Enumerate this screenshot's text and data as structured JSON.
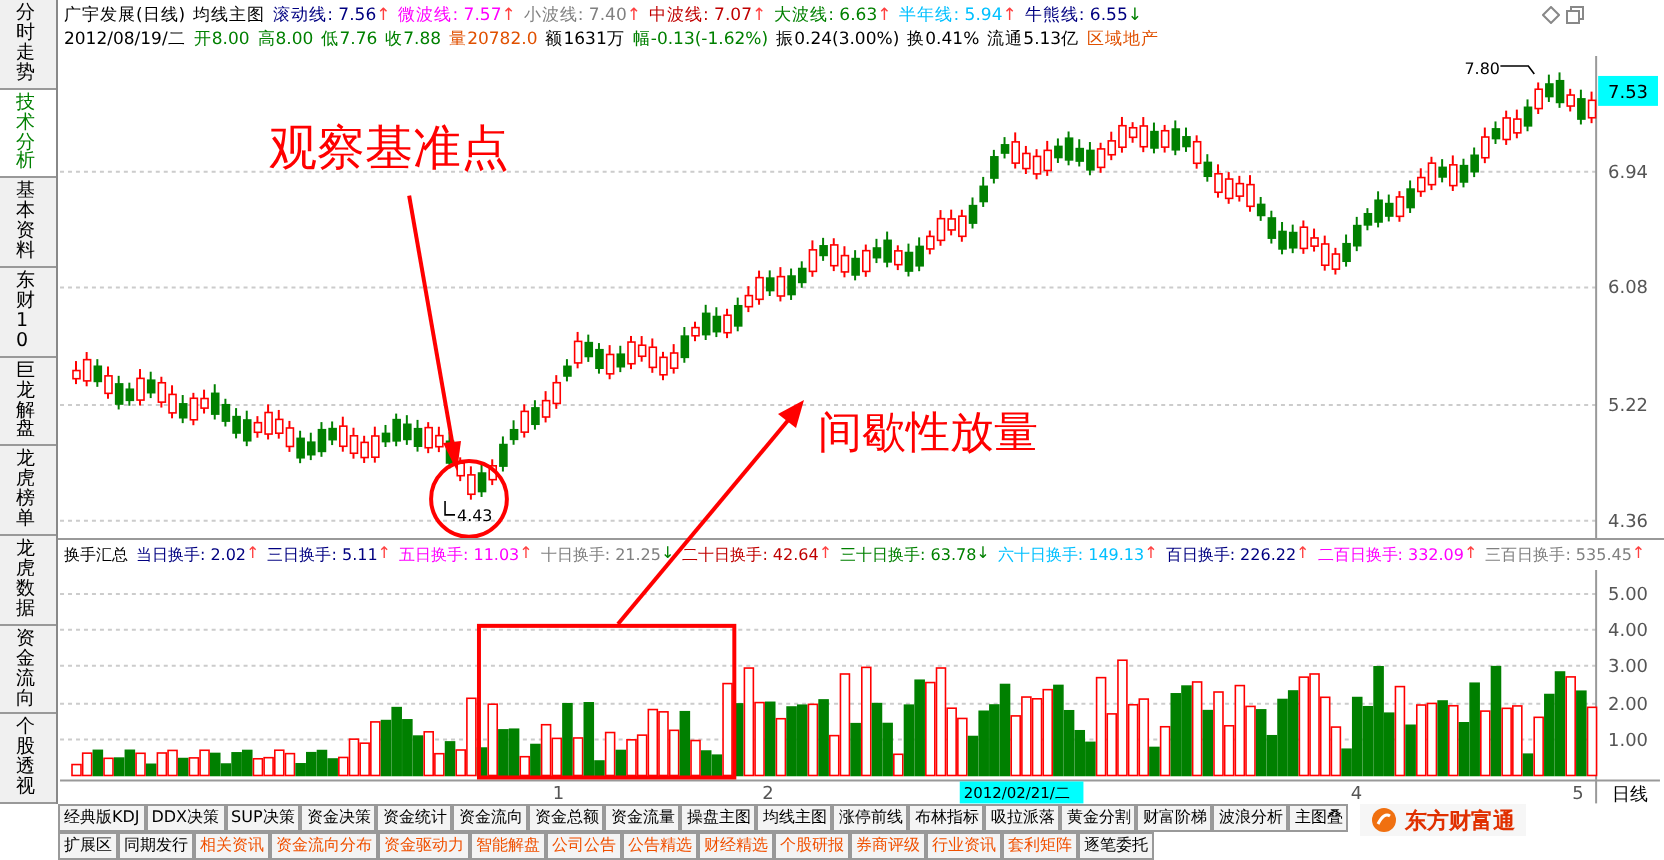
{
  "side_tabs": [
    {
      "label": "分时走势",
      "selected": false
    },
    {
      "label": "技术分析",
      "selected": true
    },
    {
      "label": "基本资料",
      "selected": false
    },
    {
      "label": "东财10",
      "selected": false
    },
    {
      "label": "巨龙解盘",
      "selected": false
    },
    {
      "label": "龙虎榜单",
      "selected": false
    },
    {
      "label": "龙虎数据",
      "selected": false
    },
    {
      "label": "资金流向",
      "selected": false
    },
    {
      "label": "个股透视",
      "selected": false
    }
  ],
  "header": {
    "title": "广宇发展(日线)",
    "indicator": "均线主图",
    "lines": [
      {
        "name": "滚动线:",
        "value": "7.56",
        "arrow": "↑",
        "up": true,
        "color": "#000080"
      },
      {
        "name": "微波线:",
        "value": "7.57",
        "arrow": "↑",
        "up": true,
        "color": "#ff00ff"
      },
      {
        "name": "小波线:",
        "value": "7.40",
        "arrow": "↑",
        "up": true,
        "color": "#808080"
      },
      {
        "name": "中波线:",
        "value": "7.07",
        "arrow": "↑",
        "up": true,
        "color": "#c00000"
      },
      {
        "name": "大波线:",
        "value": "6.63",
        "arrow": "↑",
        "up": true,
        "color": "#008000"
      },
      {
        "name": "半年线:",
        "value": "5.94",
        "arrow": "↑",
        "up": true,
        "color": "#00c0ff"
      },
      {
        "name": "牛熊线:",
        "value": "6.55",
        "arrow": "↓",
        "up": false,
        "color": "#000080"
      }
    ]
  },
  "quote": {
    "date": "2012/08/19/二",
    "items": [
      {
        "label": "开",
        "value": "8.00",
        "color": "#008000"
      },
      {
        "label": "高",
        "value": "8.00",
        "color": "#008000"
      },
      {
        "label": "低",
        "value": "7.76",
        "color": "#008000"
      },
      {
        "label": "收",
        "value": "7.88",
        "color": "#008000"
      },
      {
        "label": "量",
        "value": "20782.0",
        "color": "#e05000"
      },
      {
        "label": "额",
        "value": "1631万",
        "color": "#000000"
      },
      {
        "label": "幅",
        "value": "-0.13(-1.62%)",
        "color": "#008000"
      },
      {
        "label": "振",
        "value": "0.24(3.00%)",
        "color": "#000000"
      },
      {
        "label": "换",
        "value": "0.41%",
        "color": "#000000"
      },
      {
        "label": "流通",
        "value": "5.13亿",
        "color": "#000000"
      }
    ],
    "sector": "区域地产"
  },
  "price_axis": {
    "current": "7.53",
    "ticks": [
      "6.94",
      "6.08",
      "5.22",
      "4.36"
    ]
  },
  "annotations": {
    "base_point": "观察基准点",
    "low_label": "4.43",
    "high_label": "7.80",
    "volume_note": "间歇性放量"
  },
  "turnover": {
    "title": "换手汇总",
    "items": [
      {
        "name": "当日换手:",
        "value": "2.02",
        "arrow": "↑",
        "up": true,
        "color": "#000080"
      },
      {
        "name": "三日换手:",
        "value": "5.11",
        "arrow": "↑",
        "up": true,
        "color": "#000080"
      },
      {
        "name": "五日换手:",
        "value": "11.03",
        "arrow": "↑",
        "up": true,
        "color": "#ff00ff"
      },
      {
        "name": "十日换手:",
        "value": "21.25",
        "arrow": "↓",
        "up": false,
        "color": "#808080"
      },
      {
        "name": "二十日换手:",
        "value": "42.64",
        "arrow": "↑",
        "up": true,
        "color": "#c00000"
      },
      {
        "name": "三十日换手:",
        "value": "63.78",
        "arrow": "↓",
        "up": false,
        "color": "#008000"
      },
      {
        "name": "六十日换手:",
        "value": "149.13",
        "arrow": "↑",
        "up": true,
        "color": "#00c0ff"
      },
      {
        "name": "百日换手:",
        "value": "226.22",
        "arrow": "↑",
        "up": true,
        "color": "#000080"
      },
      {
        "name": "二百日换手:",
        "value": "332.09",
        "arrow": "↑",
        "up": true,
        "color": "#ff00ff"
      },
      {
        "name": "三百日换手:",
        "value": "535.45",
        "arrow": "↑",
        "up": true,
        "color": "#808080"
      }
    ]
  },
  "volume_axis": {
    "ticks": [
      "5.00",
      "4.00",
      "3.00",
      "2.00",
      "1.00"
    ]
  },
  "time_axis": {
    "labels": [
      "1",
      "2",
      "4",
      "5"
    ],
    "current": "2012/02/21/二",
    "period": "日线"
  },
  "bottom_tabs": [
    [
      {
        "label": "经典版KDJ",
        "highlight": false
      },
      {
        "label": "DDX决策",
        "highlight": false
      },
      {
        "label": "SUP决策",
        "highlight": false
      },
      {
        "label": "资金决策",
        "highlight": false
      },
      {
        "label": "资金统计",
        "highlight": false
      },
      {
        "label": "资金流向",
        "highlight": false
      },
      {
        "label": "资金总额",
        "highlight": false
      },
      {
        "label": "资金流量",
        "highlight": false
      },
      {
        "label": "操盘主图",
        "highlight": false
      },
      {
        "label": "均线主图",
        "highlight": false
      },
      {
        "label": "涨停前线",
        "highlight": false
      },
      {
        "label": "布林指标",
        "highlight": false
      },
      {
        "label": "吸拉派落",
        "highlight": false
      },
      {
        "label": "黄金分割",
        "highlight": false
      },
      {
        "label": "财富阶梯",
        "highlight": false
      },
      {
        "label": "波浪分析",
        "highlight": false
      },
      {
        "label": "主图叠",
        "highlight": false
      }
    ],
    [
      {
        "label": "扩展区",
        "highlight": false
      },
      {
        "label": "同期发行",
        "highlight": false
      },
      {
        "label": "相关资讯",
        "highlight": true
      },
      {
        "label": "资金流向分布",
        "highlight": true
      },
      {
        "label": "资金驱动力",
        "highlight": true
      },
      {
        "label": "智能解盘",
        "highlight": true
      },
      {
        "label": "公司公告",
        "highlight": true
      },
      {
        "label": "公告精选",
        "highlight": true
      },
      {
        "label": "财经精选",
        "highlight": true
      },
      {
        "label": "个股研报",
        "highlight": true
      },
      {
        "label": "券商评级",
        "highlight": true
      },
      {
        "label": "行业资讯",
        "highlight": true
      },
      {
        "label": "套利矩阵",
        "highlight": true
      },
      {
        "label": "逐笔委托",
        "highlight": false
      }
    ]
  ],
  "brand": "东方财富通"
}
